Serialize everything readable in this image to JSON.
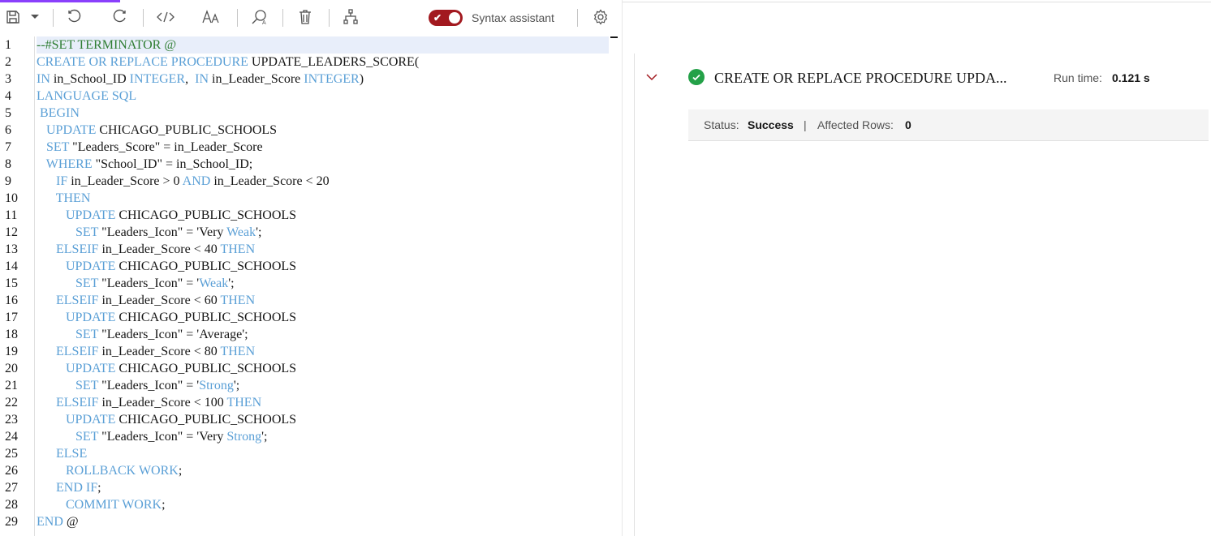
{
  "toolbar": {
    "syntax_assistant_label": "Syntax assistant",
    "syntax_assistant_on": true,
    "accent_color": "#a2191f"
  },
  "editor": {
    "line_numbers": [
      "1",
      "2",
      "3",
      "4",
      "5",
      "6",
      "7",
      "8",
      "9",
      "10",
      "11",
      "12",
      "13",
      "14",
      "15",
      "16",
      "17",
      "18",
      "19",
      "20",
      "21",
      "22",
      "23",
      "24",
      "25",
      "26",
      "27",
      "28",
      "29"
    ],
    "lines": [
      [
        {
          "t": "--#SET TERMINATOR @",
          "c": "cm"
        }
      ],
      [
        {
          "t": "CREATE OR REPLACE PROCEDURE",
          "c": "kw"
        },
        {
          "t": " UPDATE_LEADERS_SCORE(",
          "c": ""
        }
      ],
      [
        {
          "t": "IN",
          "c": "kw"
        },
        {
          "t": " in_School_ID ",
          "c": ""
        },
        {
          "t": "INTEGER",
          "c": "kw"
        },
        {
          "t": ",  ",
          "c": ""
        },
        {
          "t": "IN",
          "c": "kw"
        },
        {
          "t": " in_Leader_Score ",
          "c": ""
        },
        {
          "t": "INTEGER",
          "c": "kw"
        },
        {
          "t": ")",
          "c": ""
        }
      ],
      [
        {
          "t": "LANGUAGE SQL",
          "c": "kw"
        }
      ],
      [
        {
          "t": " BEGIN",
          "c": "kw"
        }
      ],
      [
        {
          "t": "   UPDATE",
          "c": "kw"
        },
        {
          "t": " CHICAGO_PUBLIC_SCHOOLS",
          "c": ""
        }
      ],
      [
        {
          "t": "   SET",
          "c": "kw"
        },
        {
          "t": " \"Leaders_Score\" = in_Leader_Score",
          "c": ""
        }
      ],
      [
        {
          "t": "   WHERE",
          "c": "kw"
        },
        {
          "t": " \"School_ID\" = in_School_ID;",
          "c": ""
        }
      ],
      [
        {
          "t": "      IF",
          "c": "kw"
        },
        {
          "t": " in_Leader_Score > 0 ",
          "c": ""
        },
        {
          "t": "AND",
          "c": "kw"
        },
        {
          "t": " in_Leader_Score < 20",
          "c": ""
        }
      ],
      [
        {
          "t": "      THEN",
          "c": "kw"
        }
      ],
      [
        {
          "t": "         UPDATE",
          "c": "kw"
        },
        {
          "t": " CHICAGO_PUBLIC_SCHOOLS",
          "c": ""
        }
      ],
      [
        {
          "t": "            SET",
          "c": "kw"
        },
        {
          "t": " \"Leaders_Icon\" = 'Very ",
          "c": ""
        },
        {
          "t": "Weak",
          "c": "kw"
        },
        {
          "t": "';",
          "c": ""
        }
      ],
      [
        {
          "t": "      ELSEIF",
          "c": "kw"
        },
        {
          "t": " in_Leader_Score < 40 ",
          "c": ""
        },
        {
          "t": "THEN",
          "c": "kw"
        }
      ],
      [
        {
          "t": "         UPDATE",
          "c": "kw"
        },
        {
          "t": " CHICAGO_PUBLIC_SCHOOLS",
          "c": ""
        }
      ],
      [
        {
          "t": "            SET",
          "c": "kw"
        },
        {
          "t": " \"Leaders_Icon\" = '",
          "c": ""
        },
        {
          "t": "Weak",
          "c": "kw"
        },
        {
          "t": "';",
          "c": ""
        }
      ],
      [
        {
          "t": "      ELSEIF",
          "c": "kw"
        },
        {
          "t": " in_Leader_Score < 60 ",
          "c": ""
        },
        {
          "t": "THEN",
          "c": "kw"
        }
      ],
      [
        {
          "t": "         UPDATE",
          "c": "kw"
        },
        {
          "t": " CHICAGO_PUBLIC_SCHOOLS",
          "c": ""
        }
      ],
      [
        {
          "t": "            SET",
          "c": "kw"
        },
        {
          "t": " \"Leaders_Icon\" = 'Average';",
          "c": ""
        }
      ],
      [
        {
          "t": "      ELSEIF",
          "c": "kw"
        },
        {
          "t": " in_Leader_Score < 80 ",
          "c": ""
        },
        {
          "t": "THEN",
          "c": "kw"
        }
      ],
      [
        {
          "t": "         UPDATE",
          "c": "kw"
        },
        {
          "t": " CHICAGO_PUBLIC_SCHOOLS",
          "c": ""
        }
      ],
      [
        {
          "t": "            SET",
          "c": "kw"
        },
        {
          "t": " \"Leaders_Icon\" = '",
          "c": ""
        },
        {
          "t": "Strong",
          "c": "kw"
        },
        {
          "t": "';",
          "c": ""
        }
      ],
      [
        {
          "t": "      ELSEIF",
          "c": "kw"
        },
        {
          "t": " in_Leader_Score < 100 ",
          "c": ""
        },
        {
          "t": "THEN",
          "c": "kw"
        }
      ],
      [
        {
          "t": "         UPDATE",
          "c": "kw"
        },
        {
          "t": " CHICAGO_PUBLIC_SCHOOLS",
          "c": ""
        }
      ],
      [
        {
          "t": "            SET",
          "c": "kw"
        },
        {
          "t": " \"Leaders_Icon\" = 'Very ",
          "c": ""
        },
        {
          "t": "Strong",
          "c": "kw"
        },
        {
          "t": "';",
          "c": ""
        }
      ],
      [
        {
          "t": "      ELSE",
          "c": "kw"
        }
      ],
      [
        {
          "t": "         ROLLBACK WORK",
          "c": "kw"
        },
        {
          "t": ";",
          "c": ""
        }
      ],
      [
        {
          "t": "      END IF",
          "c": "kw"
        },
        {
          "t": ";",
          "c": ""
        }
      ],
      [
        {
          "t": "         COMMIT WORK",
          "c": "kw"
        },
        {
          "t": ";",
          "c": ""
        }
      ],
      [
        {
          "t": "END",
          "c": "kw"
        },
        {
          "t": " @",
          "c": ""
        }
      ]
    ]
  },
  "result": {
    "title": "CREATE OR REPLACE PROCEDURE UPDA...",
    "run_time_label": "Run time:",
    "run_time_value": "0.121 s",
    "status_label": "Status:",
    "status_value": "Success",
    "separator": "|",
    "affected_rows_label": "Affected Rows:",
    "affected_rows_value": "0"
  }
}
